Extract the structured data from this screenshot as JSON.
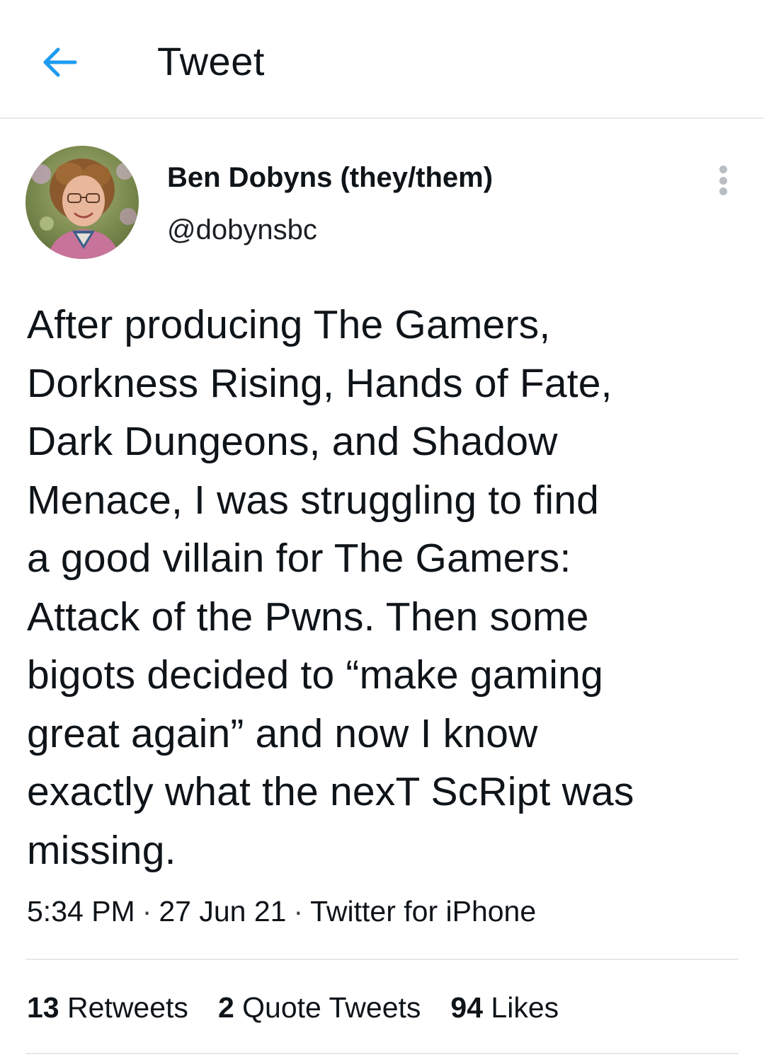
{
  "header": {
    "title": "Tweet",
    "back_icon": "arrow-left-icon",
    "accent_color": "#1d9bf0"
  },
  "author": {
    "display_name": "Ben Dobyns (they/them)",
    "handle": "@dobynsbc",
    "more_icon": "vertical-ellipsis-icon"
  },
  "tweet": {
    "text": "After producing The Gamers,\nDorkness Rising, Hands of Fate,\nDark Dungeons, and Shadow\nMenace, I was struggling to find\na good villain for The Gamers:\nAttack of the Pwns. Then some\nbigots decided to “make gaming\ngreat again” and now I know\nexactly what the nexT ScRipt was\nmissing.",
    "time": "5:34 PM",
    "date": "27 Jun 21",
    "source": "Twitter for iPhone",
    "separator": "·"
  },
  "stats": {
    "retweets_count": "13",
    "retweets_label": "Retweets",
    "quotes_count": "2",
    "quotes_label": "Quote Tweets",
    "likes_count": "94",
    "likes_label": "Likes"
  }
}
